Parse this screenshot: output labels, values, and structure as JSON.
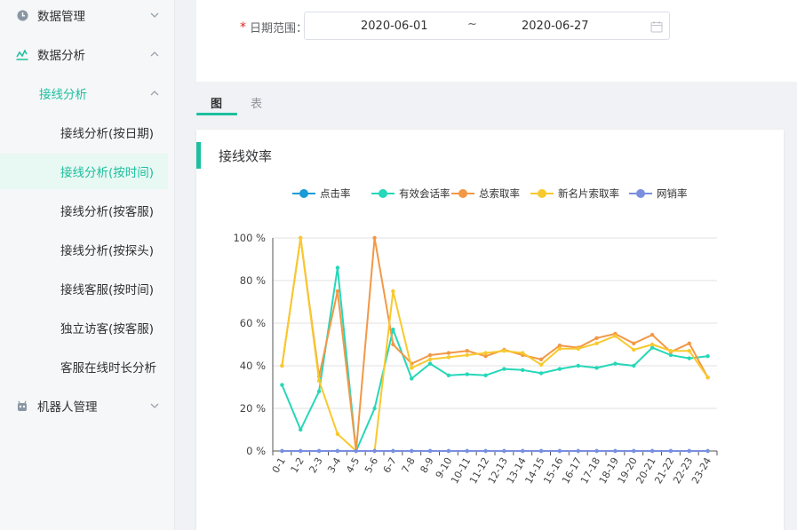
{
  "sidebar": {
    "items": [
      {
        "label": "数据管理",
        "icon": "clock-icon",
        "arrow": "chevron-down-icon"
      },
      {
        "label": "数据分析",
        "icon": "analytics-icon",
        "arrow": "chevron-up-icon"
      },
      {
        "label": "接线分析",
        "arrow": "chevron-up-icon"
      },
      {
        "label": "接线分析(按日期)"
      },
      {
        "label": "接线分析(按时间)"
      },
      {
        "label": "接线分析(按客服)"
      },
      {
        "label": "接线分析(按探头)"
      },
      {
        "label": "接线客服(按时间)"
      },
      {
        "label": "独立访客(按客服)"
      },
      {
        "label": "客服在线时长分析"
      },
      {
        "label": "机器人管理",
        "icon": "robot-icon",
        "arrow": "chevron-down-icon"
      }
    ]
  },
  "filter": {
    "required_mark": "*",
    "label": "日期范围：",
    "start_date": "2020-06-01",
    "separator": "~",
    "end_date": "2020-06-27"
  },
  "tabs": [
    {
      "label": "图"
    },
    {
      "label": "表"
    }
  ],
  "card": {
    "title": "接线效率"
  },
  "colors": {
    "accent": "#1dbf9e",
    "series": [
      "#1a9bd6",
      "#26d7b9",
      "#f29846",
      "#f8c92d",
      "#7a8fe0"
    ]
  },
  "chart_data": {
    "type": "line",
    "title": "",
    "xlabel": "",
    "ylabel": "",
    "ylim": [
      0,
      100
    ],
    "yticks": [
      "0 %",
      "20 %",
      "40 %",
      "60 %",
      "80 %",
      "100 %"
    ],
    "legend_position": "top-center",
    "categories": [
      "0-1",
      "1-2",
      "2-3",
      "3-4",
      "4-5",
      "5-6",
      "6-7",
      "7-8",
      "8-9",
      "9-10",
      "10-11",
      "11-12",
      "12-13",
      "13-14",
      "14-15",
      "15-16",
      "16-17",
      "17-18",
      "18-19",
      "19-20",
      "20-21",
      "21-22",
      "22-23",
      "23-24"
    ],
    "series": [
      {
        "name": "点击率",
        "values": [
          0,
          0,
          0,
          0,
          0,
          0,
          0,
          0,
          0,
          0,
          0,
          0,
          0,
          0,
          0,
          0,
          0,
          0,
          0,
          0,
          0,
          0,
          0,
          0
        ]
      },
      {
        "name": "有效会话率",
        "values": [
          31,
          10,
          28,
          86,
          0,
          20,
          57,
          34,
          41,
          35.5,
          36,
          35.5,
          38.5,
          38,
          36.5,
          38.5,
          40,
          39,
          41,
          40,
          48.5,
          45,
          43.5,
          44.5
        ]
      },
      {
        "name": "总索取率",
        "values": [
          40,
          100,
          35,
          75,
          0,
          100,
          50,
          41,
          45,
          46,
          47,
          44.5,
          47.5,
          45,
          43,
          49.5,
          48.5,
          53,
          55,
          50.5,
          54.5,
          46.5,
          50.5,
          34.5
        ]
      },
      {
        "name": "新名片索取率",
        "values": [
          40,
          100,
          33,
          8,
          0,
          0,
          75,
          39,
          43,
          44,
          45,
          46,
          47,
          46,
          40.5,
          48,
          48,
          50.5,
          54,
          47.5,
          50,
          47,
          47,
          34.5
        ]
      },
      {
        "name": "网销率",
        "values": [
          0,
          0,
          0,
          0,
          0,
          0,
          0,
          0,
          0,
          0,
          0,
          0,
          0,
          0,
          0,
          0,
          0,
          0,
          0,
          0,
          0,
          0,
          0,
          0
        ]
      }
    ]
  }
}
